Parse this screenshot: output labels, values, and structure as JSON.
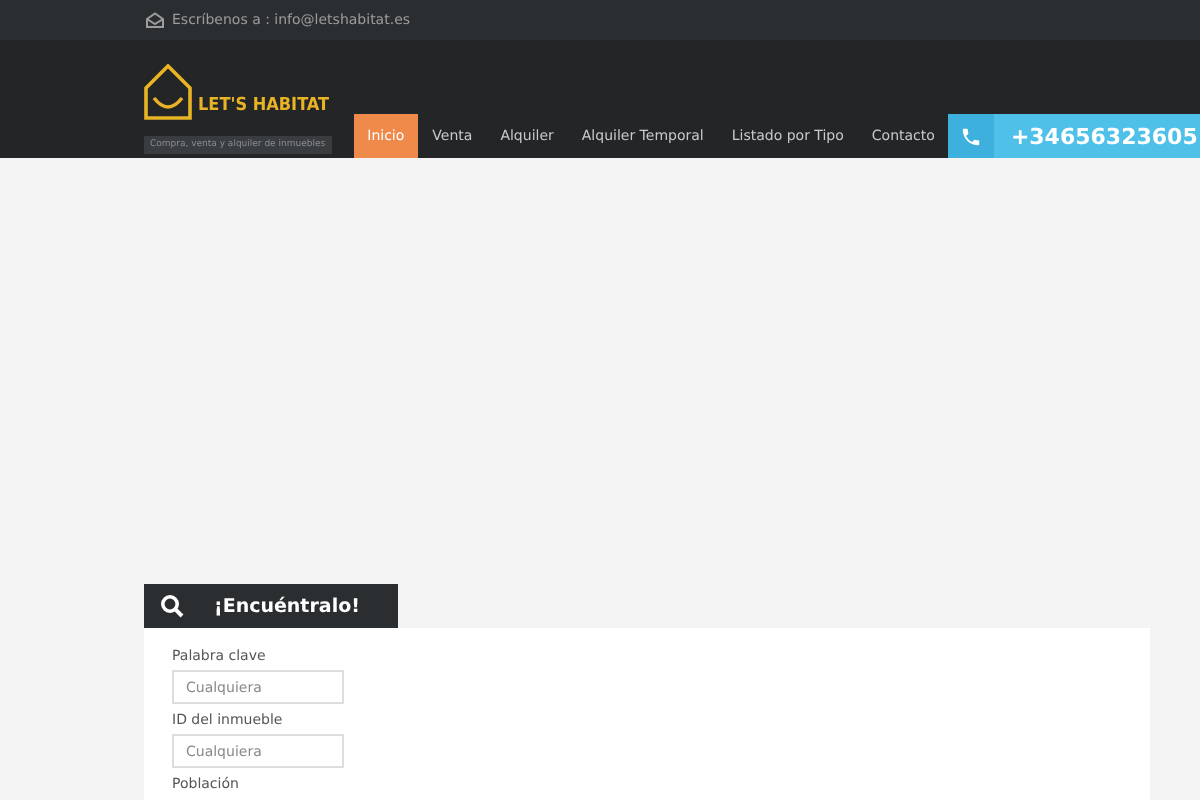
{
  "top_bar": {
    "contact_label": "Escríbenos a : info@letshabitat.es"
  },
  "header": {
    "logo_text": "LET'S HABITAT",
    "tagline": "Compra, venta y alquiler de inmuebles",
    "nav": [
      {
        "label": "Inicio",
        "selected": true
      },
      {
        "label": "Venta",
        "selected": false
      },
      {
        "label": "Alquiler",
        "selected": false
      },
      {
        "label": "Alquiler Temporal",
        "selected": false
      },
      {
        "label": "Listado por Tipo",
        "selected": false
      },
      {
        "label": "Contacto",
        "selected": false
      }
    ],
    "phone": "+34656323605"
  },
  "search": {
    "title": "¡Encuéntralo!",
    "fields": [
      {
        "label": "Palabra clave",
        "placeholder": "Cualquiera"
      },
      {
        "label": "ID del inmueble",
        "placeholder": "Cualquiera"
      }
    ],
    "next_label": "Población"
  }
}
